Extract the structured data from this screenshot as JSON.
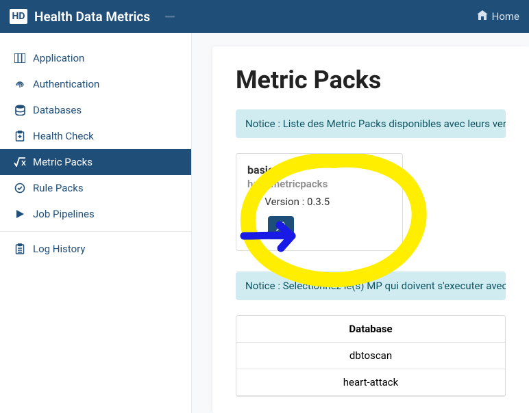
{
  "header": {
    "logo_text": "HD",
    "app_title": "Health Data Metrics",
    "home_label": "Home"
  },
  "sidebar": {
    "items": [
      {
        "label": "Application",
        "icon": "columns-icon"
      },
      {
        "label": "Authentication",
        "icon": "fingerprint-icon"
      },
      {
        "label": "Databases",
        "icon": "database-icon"
      },
      {
        "label": "Health Check",
        "icon": "clipboard-icon"
      },
      {
        "label": "Metric Packs",
        "icon": "sqrt-icon"
      },
      {
        "label": "Rule Packs",
        "icon": "check-circle-icon"
      },
      {
        "label": "Job Pipelines",
        "icon": "play-icon"
      },
      {
        "label": "Log History",
        "icon": "list-icon"
      }
    ],
    "active_index": 4
  },
  "main": {
    "title": "Metric Packs",
    "notice1": "Notice : Liste des Metric Packs disponibles avec leurs versi",
    "pack": {
      "name": "basic",
      "namespace": "hdm.metricpacks",
      "version_label": "Version : 0.3.5"
    },
    "notice2": "Notice : Selectionnez le(s) MP qui doivent s'executer avec",
    "table": {
      "header": "Database",
      "rows": [
        "dbtoscan",
        "heart-attack"
      ]
    }
  }
}
